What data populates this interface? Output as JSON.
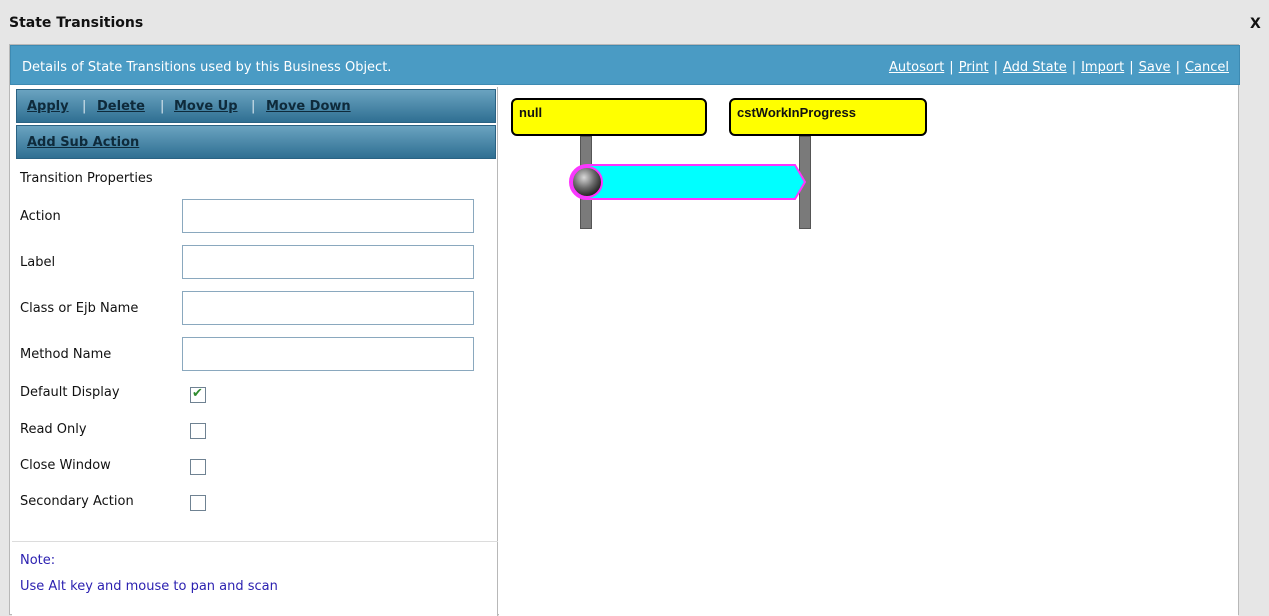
{
  "window": {
    "title": "State Transitions",
    "close_label": "X"
  },
  "header": {
    "description": "Details of State Transitions used by this Business Object.",
    "links": [
      "Autosort",
      "Print",
      "Add State",
      "Import",
      "Save",
      "Cancel"
    ],
    "separator": "|"
  },
  "toolbar1": {
    "items": [
      "Apply",
      "Delete",
      "Move Up",
      "Move Down"
    ],
    "separator": "|"
  },
  "toolbar2": {
    "items": [
      "Add Sub Action"
    ]
  },
  "properties": {
    "section_title": "Transition Properties",
    "fields": [
      {
        "label": "Action",
        "value": ""
      },
      {
        "label": "Label",
        "value": ""
      },
      {
        "label": "Class or Ejb Name",
        "value": ""
      },
      {
        "label": "Method Name",
        "value": ""
      }
    ],
    "checkboxes": [
      {
        "label": "Default Display",
        "checked": true
      },
      {
        "label": "Read Only",
        "checked": false
      },
      {
        "label": "Close Window",
        "checked": false
      },
      {
        "label": "Secondary Action",
        "checked": false
      }
    ]
  },
  "note": {
    "line1": "Note:",
    "line2": "Use Alt key and mouse to pan and scan"
  },
  "diagram": {
    "states": [
      {
        "name": "null",
        "color": "#ffff00"
      },
      {
        "name": "cstWorkInProgress",
        "color": "#ffff00"
      }
    ],
    "transition": {
      "from": "null",
      "to": "cstWorkInProgress",
      "fill": "#00ffff",
      "stroke": "#ff33ff"
    }
  },
  "colors": {
    "header": "#4a9bc4",
    "toolbar": "#2f6f92",
    "note_text": "#2a1fb0",
    "check": "#2e8b2e"
  }
}
